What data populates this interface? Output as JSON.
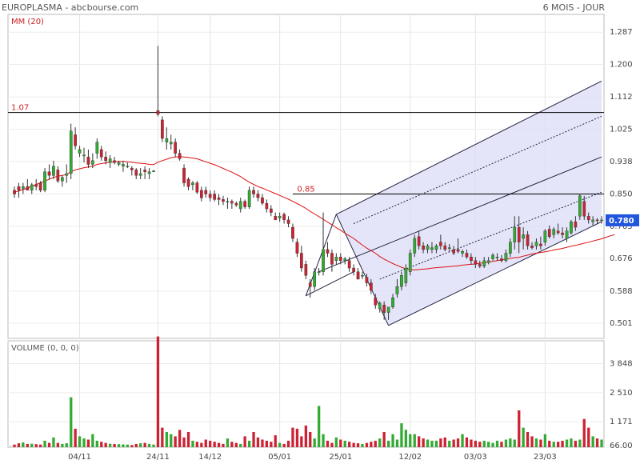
{
  "header": {
    "title": "EUROPLASMA - abcbourse.com",
    "period": "6 MOIS - JOUR"
  },
  "price_panel": {
    "indicator": "MM (20)",
    "y_ticks": [
      "1.287",
      "1.200",
      "1.112",
      "1.025",
      "0.938",
      "0.850",
      "0.763",
      "0.676",
      "0.588",
      "0.501"
    ],
    "ylim": [
      0.46,
      1.335
    ],
    "current_price": "0.780",
    "levels": [
      {
        "label": "1.07",
        "value": 1.07
      },
      {
        "label": "0.85",
        "value": 0.85
      }
    ],
    "colors": {
      "up": "#33aa33",
      "down": "#cc2233",
      "ma": "#dd1111",
      "channel_fill": "#dcdcf8",
      "badge": "#2255dd"
    }
  },
  "volume_panel": {
    "indicator": "VOLUME (0, 0, 0)",
    "y_ticks": [
      "3 848",
      "2 510",
      "1 171",
      "66.00"
    ],
    "ylim": [
      0,
      4900
    ]
  },
  "x_axis": {
    "labels": [
      "04/11",
      "24/11",
      "14/12",
      "05/01",
      "25/01",
      "12/02",
      "03/03",
      "23/03"
    ]
  },
  "chart_data": {
    "type": "candlestick",
    "candles": [
      {
        "o": 0.86,
        "h": 0.87,
        "l": 0.84,
        "c": 0.85
      },
      {
        "o": 0.87,
        "h": 0.88,
        "l": 0.84,
        "c": 0.86
      },
      {
        "o": 0.865,
        "h": 0.88,
        "l": 0.85,
        "c": 0.87
      },
      {
        "o": 0.87,
        "h": 0.89,
        "l": 0.86,
        "c": 0.86
      },
      {
        "o": 0.86,
        "h": 0.88,
        "l": 0.85,
        "c": 0.875
      },
      {
        "o": 0.875,
        "h": 0.89,
        "l": 0.86,
        "c": 0.87
      },
      {
        "o": 0.88,
        "h": 0.885,
        "l": 0.855,
        "c": 0.86
      },
      {
        "o": 0.86,
        "h": 0.92,
        "l": 0.855,
        "c": 0.91
      },
      {
        "o": 0.91,
        "h": 0.93,
        "l": 0.89,
        "c": 0.9
      },
      {
        "o": 0.9,
        "h": 0.94,
        "l": 0.89,
        "c": 0.925
      },
      {
        "o": 0.915,
        "h": 0.925,
        "l": 0.88,
        "c": 0.885
      },
      {
        "o": 0.885,
        "h": 0.9,
        "l": 0.87,
        "c": 0.895
      },
      {
        "o": 0.9,
        "h": 0.93,
        "l": 0.88,
        "c": 0.905
      },
      {
        "o": 0.905,
        "h": 1.04,
        "l": 0.89,
        "c": 1.02
      },
      {
        "o": 1.01,
        "h": 1.03,
        "l": 0.97,
        "c": 0.98
      },
      {
        "o": 0.96,
        "h": 0.98,
        "l": 0.95,
        "c": 0.97
      },
      {
        "o": 0.955,
        "h": 0.975,
        "l": 0.935,
        "c": 0.955
      },
      {
        "o": 0.95,
        "h": 0.97,
        "l": 0.92,
        "c": 0.93
      },
      {
        "o": 0.93,
        "h": 0.96,
        "l": 0.92,
        "c": 0.94
      },
      {
        "o": 0.96,
        "h": 1.0,
        "l": 0.945,
        "c": 0.99
      },
      {
        "o": 0.97,
        "h": 0.98,
        "l": 0.94,
        "c": 0.95
      },
      {
        "o": 0.95,
        "h": 0.965,
        "l": 0.93,
        "c": 0.94
      },
      {
        "o": 0.935,
        "h": 0.955,
        "l": 0.92,
        "c": 0.945
      },
      {
        "o": 0.94,
        "h": 0.95,
        "l": 0.93,
        "c": 0.935
      },
      {
        "o": 0.93,
        "h": 0.94,
        "l": 0.925,
        "c": 0.935
      },
      {
        "o": 0.925,
        "h": 0.94,
        "l": 0.91,
        "c": 0.93
      },
      {
        "o": 0.925,
        "h": 0.935,
        "l": 0.92,
        "c": 0.925
      },
      {
        "o": 0.92,
        "h": 0.925,
        "l": 0.9,
        "c": 0.915
      },
      {
        "o": 0.915,
        "h": 0.92,
        "l": 0.89,
        "c": 0.9
      },
      {
        "o": 0.9,
        "h": 0.92,
        "l": 0.89,
        "c": 0.905
      },
      {
        "o": 0.915,
        "h": 0.925,
        "l": 0.89,
        "c": 0.91
      },
      {
        "o": 0.905,
        "h": 0.92,
        "l": 0.89,
        "c": 0.91
      },
      {
        "o": 0.91,
        "h": 0.915,
        "l": 0.91,
        "c": 0.912
      },
      {
        "o": 1.075,
        "h": 1.25,
        "l": 1.06,
        "c": 1.065
      },
      {
        "o": 1.05,
        "h": 1.06,
        "l": 0.99,
        "c": 1.0
      },
      {
        "o": 0.99,
        "h": 1.03,
        "l": 0.97,
        "c": 1.0
      },
      {
        "o": 0.985,
        "h": 1.01,
        "l": 0.97,
        "c": 0.99
      },
      {
        "o": 0.99,
        "h": 1.0,
        "l": 0.95,
        "c": 0.96
      },
      {
        "o": 0.96,
        "h": 0.97,
        "l": 0.94,
        "c": 0.945
      },
      {
        "o": 0.92,
        "h": 0.93,
        "l": 0.87,
        "c": 0.88
      },
      {
        "o": 0.89,
        "h": 0.895,
        "l": 0.86,
        "c": 0.87
      },
      {
        "o": 0.875,
        "h": 0.885,
        "l": 0.86,
        "c": 0.88
      },
      {
        "o": 0.88,
        "h": 0.885,
        "l": 0.85,
        "c": 0.855
      },
      {
        "o": 0.86,
        "h": 0.87,
        "l": 0.83,
        "c": 0.84
      },
      {
        "o": 0.86,
        "h": 0.87,
        "l": 0.84,
        "c": 0.85
      },
      {
        "o": 0.85,
        "h": 0.86,
        "l": 0.83,
        "c": 0.84
      },
      {
        "o": 0.85,
        "h": 0.86,
        "l": 0.83,
        "c": 0.835
      },
      {
        "o": 0.84,
        "h": 0.85,
        "l": 0.82,
        "c": 0.835
      },
      {
        "o": 0.835,
        "h": 0.845,
        "l": 0.82,
        "c": 0.83
      },
      {
        "o": 0.83,
        "h": 0.84,
        "l": 0.81,
        "c": 0.83
      },
      {
        "o": 0.83,
        "h": 0.835,
        "l": 0.81,
        "c": 0.825
      },
      {
        "o": 0.825,
        "h": 0.83,
        "l": 0.815,
        "c": 0.82
      },
      {
        "o": 0.81,
        "h": 0.84,
        "l": 0.8,
        "c": 0.83
      },
      {
        "o": 0.83,
        "h": 0.835,
        "l": 0.81,
        "c": 0.815
      },
      {
        "o": 0.815,
        "h": 0.87,
        "l": 0.81,
        "c": 0.86
      },
      {
        "o": 0.86,
        "h": 0.87,
        "l": 0.84,
        "c": 0.85
      },
      {
        "o": 0.85,
        "h": 0.86,
        "l": 0.83,
        "c": 0.84
      },
      {
        "o": 0.84,
        "h": 0.85,
        "l": 0.82,
        "c": 0.825
      },
      {
        "o": 0.825,
        "h": 0.835,
        "l": 0.8,
        "c": 0.81
      },
      {
        "o": 0.81,
        "h": 0.82,
        "l": 0.79,
        "c": 0.8
      },
      {
        "o": 0.79,
        "h": 0.8,
        "l": 0.78,
        "c": 0.78
      },
      {
        "o": 0.785,
        "h": 0.8,
        "l": 0.775,
        "c": 0.79
      },
      {
        "o": 0.795,
        "h": 0.8,
        "l": 0.77,
        "c": 0.78
      },
      {
        "o": 0.78,
        "h": 0.79,
        "l": 0.76,
        "c": 0.77
      },
      {
        "o": 0.76,
        "h": 0.77,
        "l": 0.72,
        "c": 0.73
      },
      {
        "o": 0.72,
        "h": 0.73,
        "l": 0.68,
        "c": 0.69
      },
      {
        "o": 0.69,
        "h": 0.71,
        "l": 0.64,
        "c": 0.65
      },
      {
        "o": 0.66,
        "h": 0.67,
        "l": 0.62,
        "c": 0.63
      },
      {
        "o": 0.61,
        "h": 0.62,
        "l": 0.57,
        "c": 0.6
      },
      {
        "o": 0.6,
        "h": 0.65,
        "l": 0.59,
        "c": 0.64
      },
      {
        "o": 0.64,
        "h": 0.65,
        "l": 0.63,
        "c": 0.64
      },
      {
        "o": 0.64,
        "h": 0.8,
        "l": 0.63,
        "c": 0.7
      },
      {
        "o": 0.7,
        "h": 0.72,
        "l": 0.68,
        "c": 0.69
      },
      {
        "o": 0.69,
        "h": 0.7,
        "l": 0.64,
        "c": 0.66
      },
      {
        "o": 0.67,
        "h": 0.69,
        "l": 0.66,
        "c": 0.68
      },
      {
        "o": 0.68,
        "h": 0.69,
        "l": 0.66,
        "c": 0.67
      },
      {
        "o": 0.67,
        "h": 0.68,
        "l": 0.66,
        "c": 0.675
      },
      {
        "o": 0.67,
        "h": 0.68,
        "l": 0.64,
        "c": 0.65
      },
      {
        "o": 0.65,
        "h": 0.66,
        "l": 0.63,
        "c": 0.64
      },
      {
        "o": 0.64,
        "h": 0.65,
        "l": 0.62,
        "c": 0.62
      },
      {
        "o": 0.63,
        "h": 0.64,
        "l": 0.62,
        "c": 0.63
      },
      {
        "o": 0.625,
        "h": 0.635,
        "l": 0.6,
        "c": 0.61
      },
      {
        "o": 0.61,
        "h": 0.62,
        "l": 0.58,
        "c": 0.59
      },
      {
        "o": 0.57,
        "h": 0.58,
        "l": 0.54,
        "c": 0.55
      },
      {
        "o": 0.54,
        "h": 0.56,
        "l": 0.53,
        "c": 0.555
      },
      {
        "o": 0.55,
        "h": 0.56,
        "l": 0.51,
        "c": 0.53
      },
      {
        "o": 0.53,
        "h": 0.545,
        "l": 0.51,
        "c": 0.545
      },
      {
        "o": 0.545,
        "h": 0.58,
        "l": 0.54,
        "c": 0.57
      },
      {
        "o": 0.58,
        "h": 0.62,
        "l": 0.57,
        "c": 0.6
      },
      {
        "o": 0.6,
        "h": 0.64,
        "l": 0.59,
        "c": 0.63
      },
      {
        "o": 0.61,
        "h": 0.66,
        "l": 0.6,
        "c": 0.65
      },
      {
        "o": 0.64,
        "h": 0.7,
        "l": 0.63,
        "c": 0.69
      },
      {
        "o": 0.69,
        "h": 0.74,
        "l": 0.68,
        "c": 0.73
      },
      {
        "o": 0.735,
        "h": 0.75,
        "l": 0.7,
        "c": 0.71
      },
      {
        "o": 0.71,
        "h": 0.72,
        "l": 0.69,
        "c": 0.7
      },
      {
        "o": 0.7,
        "h": 0.715,
        "l": 0.69,
        "c": 0.71
      },
      {
        "o": 0.7,
        "h": 0.72,
        "l": 0.69,
        "c": 0.705
      },
      {
        "o": 0.7,
        "h": 0.715,
        "l": 0.69,
        "c": 0.71
      },
      {
        "o": 0.72,
        "h": 0.74,
        "l": 0.7,
        "c": 0.71
      },
      {
        "o": 0.71,
        "h": 0.72,
        "l": 0.695,
        "c": 0.7
      },
      {
        "o": 0.705,
        "h": 0.715,
        "l": 0.695,
        "c": 0.705
      },
      {
        "o": 0.7,
        "h": 0.71,
        "l": 0.685,
        "c": 0.69
      },
      {
        "o": 0.7,
        "h": 0.73,
        "l": 0.69,
        "c": 0.695
      },
      {
        "o": 0.69,
        "h": 0.7,
        "l": 0.68,
        "c": 0.695
      },
      {
        "o": 0.69,
        "h": 0.7,
        "l": 0.675,
        "c": 0.68
      },
      {
        "o": 0.68,
        "h": 0.69,
        "l": 0.66,
        "c": 0.67
      },
      {
        "o": 0.67,
        "h": 0.68,
        "l": 0.65,
        "c": 0.66
      },
      {
        "o": 0.66,
        "h": 0.67,
        "l": 0.65,
        "c": 0.655
      },
      {
        "o": 0.655,
        "h": 0.68,
        "l": 0.65,
        "c": 0.67
      },
      {
        "o": 0.665,
        "h": 0.68,
        "l": 0.66,
        "c": 0.67
      },
      {
        "o": 0.675,
        "h": 0.69,
        "l": 0.67,
        "c": 0.685
      },
      {
        "o": 0.68,
        "h": 0.69,
        "l": 0.67,
        "c": 0.68
      },
      {
        "o": 0.675,
        "h": 0.685,
        "l": 0.665,
        "c": 0.67
      },
      {
        "o": 0.67,
        "h": 0.7,
        "l": 0.665,
        "c": 0.69
      },
      {
        "o": 0.69,
        "h": 0.73,
        "l": 0.68,
        "c": 0.72
      },
      {
        "o": 0.72,
        "h": 0.79,
        "l": 0.7,
        "c": 0.76
      },
      {
        "o": 0.76,
        "h": 0.79,
        "l": 0.69,
        "c": 0.72
      },
      {
        "o": 0.73,
        "h": 0.76,
        "l": 0.7,
        "c": 0.74
      },
      {
        "o": 0.74,
        "h": 0.75,
        "l": 0.7,
        "c": 0.71
      },
      {
        "o": 0.71,
        "h": 0.72,
        "l": 0.7,
        "c": 0.705
      },
      {
        "o": 0.71,
        "h": 0.73,
        "l": 0.7,
        "c": 0.72
      },
      {
        "o": 0.715,
        "h": 0.735,
        "l": 0.7,
        "c": 0.71
      },
      {
        "o": 0.72,
        "h": 0.755,
        "l": 0.71,
        "c": 0.75
      },
      {
        "o": 0.755,
        "h": 0.765,
        "l": 0.73,
        "c": 0.735
      },
      {
        "o": 0.74,
        "h": 0.76,
        "l": 0.73,
        "c": 0.755
      },
      {
        "o": 0.75,
        "h": 0.77,
        "l": 0.74,
        "c": 0.745
      },
      {
        "o": 0.745,
        "h": 0.76,
        "l": 0.73,
        "c": 0.74
      },
      {
        "o": 0.73,
        "h": 0.76,
        "l": 0.72,
        "c": 0.75
      },
      {
        "o": 0.745,
        "h": 0.78,
        "l": 0.74,
        "c": 0.775
      },
      {
        "o": 0.775,
        "h": 0.79,
        "l": 0.75,
        "c": 0.76
      },
      {
        "o": 0.79,
        "h": 0.85,
        "l": 0.78,
        "c": 0.845
      },
      {
        "o": 0.83,
        "h": 0.845,
        "l": 0.78,
        "c": 0.79
      },
      {
        "o": 0.79,
        "h": 0.8,
        "l": 0.77,
        "c": 0.78
      },
      {
        "o": 0.775,
        "h": 0.79,
        "l": 0.765,
        "c": 0.78
      },
      {
        "o": 0.78,
        "h": 0.785,
        "l": 0.77,
        "c": 0.778
      },
      {
        "o": 0.78,
        "h": 0.79,
        "l": 0.77,
        "c": 0.78
      }
    ],
    "ma20": [
      0.855,
      0.858,
      0.862,
      0.866,
      0.871,
      0.876,
      0.88,
      0.885,
      0.89,
      0.895,
      0.898,
      0.9,
      0.903,
      0.91,
      0.915,
      0.918,
      0.921,
      0.923,
      0.925,
      0.93,
      0.932,
      0.934,
      0.936,
      0.937,
      0.938,
      0.938,
      0.937,
      0.936,
      0.934,
      0.933,
      0.932,
      0.93,
      0.929,
      0.936,
      0.94,
      0.944,
      0.948,
      0.95,
      0.951,
      0.95,
      0.949,
      0.947,
      0.945,
      0.941,
      0.937,
      0.933,
      0.929,
      0.924,
      0.919,
      0.914,
      0.909,
      0.903,
      0.897,
      0.889,
      0.882,
      0.876,
      0.87,
      0.866,
      0.861,
      0.856,
      0.851,
      0.846,
      0.841,
      0.836,
      0.83,
      0.824,
      0.818,
      0.811,
      0.803,
      0.796,
      0.789,
      0.782,
      0.774,
      0.767,
      0.759,
      0.752,
      0.744,
      0.737,
      0.73,
      0.721,
      0.712,
      0.704,
      0.697,
      0.69,
      0.681,
      0.674,
      0.668,
      0.662,
      0.657,
      0.652,
      0.648,
      0.646,
      0.645,
      0.646,
      0.647,
      0.648,
      0.65,
      0.651,
      0.652,
      0.653,
      0.654,
      0.655,
      0.656,
      0.658,
      0.659,
      0.66,
      0.661,
      0.663,
      0.664,
      0.666,
      0.668,
      0.67,
      0.672,
      0.674,
      0.676,
      0.678,
      0.679,
      0.682,
      0.685,
      0.688,
      0.69,
      0.692,
      0.694,
      0.696,
      0.699,
      0.701,
      0.703,
      0.706,
      0.709,
      0.711,
      0.714,
      0.717,
      0.72,
      0.723,
      0.726,
      0.729,
      0.733,
      0.737,
      0.74
    ],
    "volume": [
      120,
      180,
      220,
      150,
      160,
      140,
      120,
      300,
      200,
      450,
      200,
      150,
      180,
      2300,
      850,
      500,
      400,
      350,
      600,
      300,
      250,
      200,
      160,
      150,
      140,
      130,
      120,
      100,
      150,
      180,
      200,
      150,
      120,
      5100,
      900,
      700,
      600,
      500,
      800,
      450,
      700,
      300,
      250,
      200,
      350,
      300,
      250,
      200,
      150,
      400,
      250,
      200,
      150,
      500,
      300,
      700,
      450,
      350,
      300,
      250,
      550,
      200,
      150,
      300,
      900,
      850,
      500,
      1000,
      700,
      400,
      1900,
      600,
      300,
      200,
      450,
      350,
      300,
      250,
      200,
      180,
      150,
      200,
      250,
      300,
      400,
      700,
      300,
      600,
      350,
      1100,
      800,
      600,
      600,
      500,
      400,
      350,
      300,
      300,
      400,
      450,
      300,
      350,
      400,
      600,
      450,
      350,
      300,
      250,
      300,
      250,
      200,
      300,
      250,
      350,
      400,
      350,
      1700,
      900,
      700,
      500,
      400,
      350,
      600,
      300,
      250,
      250,
      300,
      350,
      400,
      300,
      350,
      1300,
      900,
      500,
      400,
      350
    ],
    "x_tick_index": [
      15,
      33,
      45,
      61,
      75,
      91,
      106,
      122
    ]
  }
}
